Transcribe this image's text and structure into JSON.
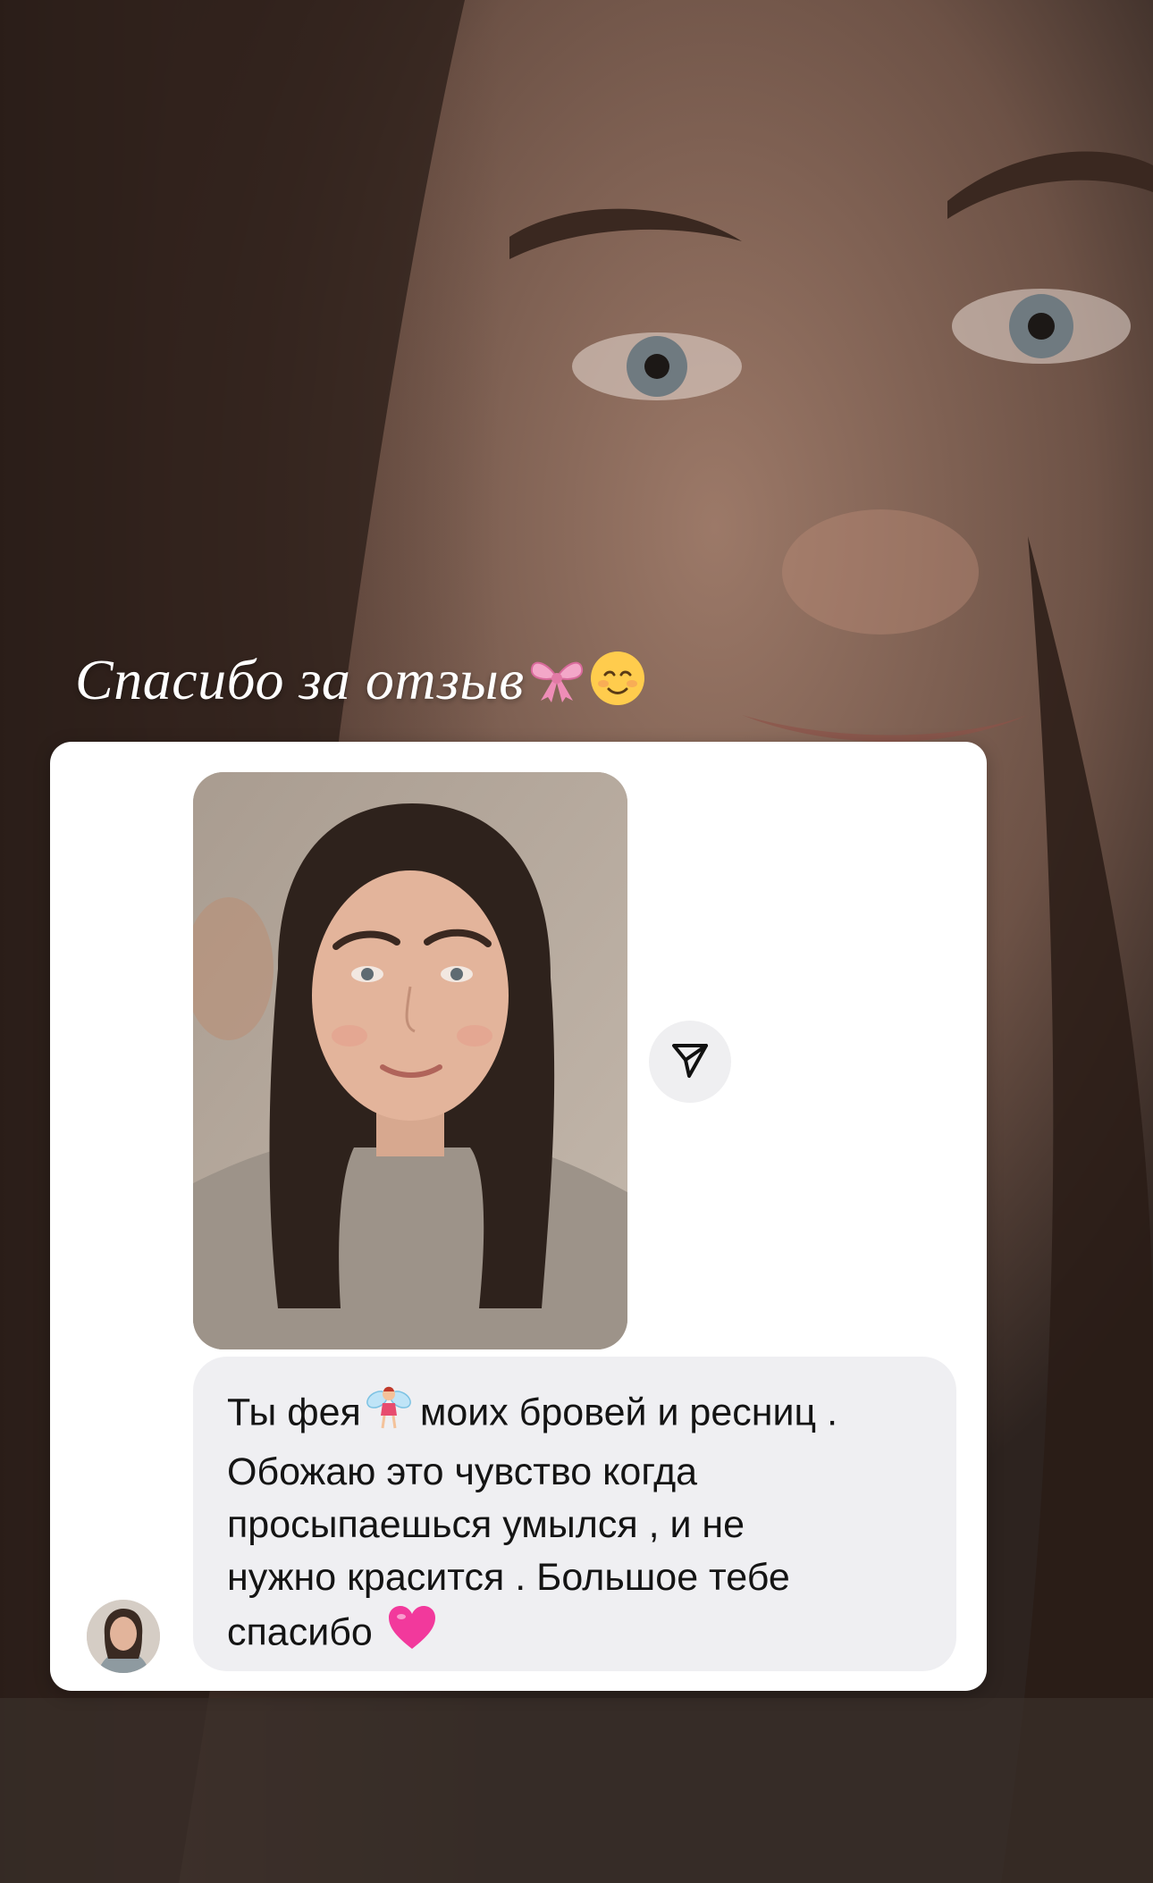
{
  "story": {
    "caption": "Спасибо за отзыв",
    "caption_emojis": [
      "ribbon-emoji",
      "smiling-face-emoji"
    ]
  },
  "message": {
    "share_icon": "send-icon",
    "lines": [
      {
        "before": "Ты фея",
        "emoji": "fairy-emoji",
        "after": "моих бровей и ресниц ."
      },
      {
        "text": "Обожаю это чувство когда"
      },
      {
        "text": "просыпаешься умылся , и не"
      },
      {
        "text": "нужно красится . Большое тебе"
      },
      {
        "text": "спасибо",
        "emoji": "pink-heart-emoji"
      }
    ]
  },
  "colors": {
    "card": "#ffffff",
    "bubble": "#efeff2",
    "text": "#141414",
    "heart": "#f2399c"
  }
}
